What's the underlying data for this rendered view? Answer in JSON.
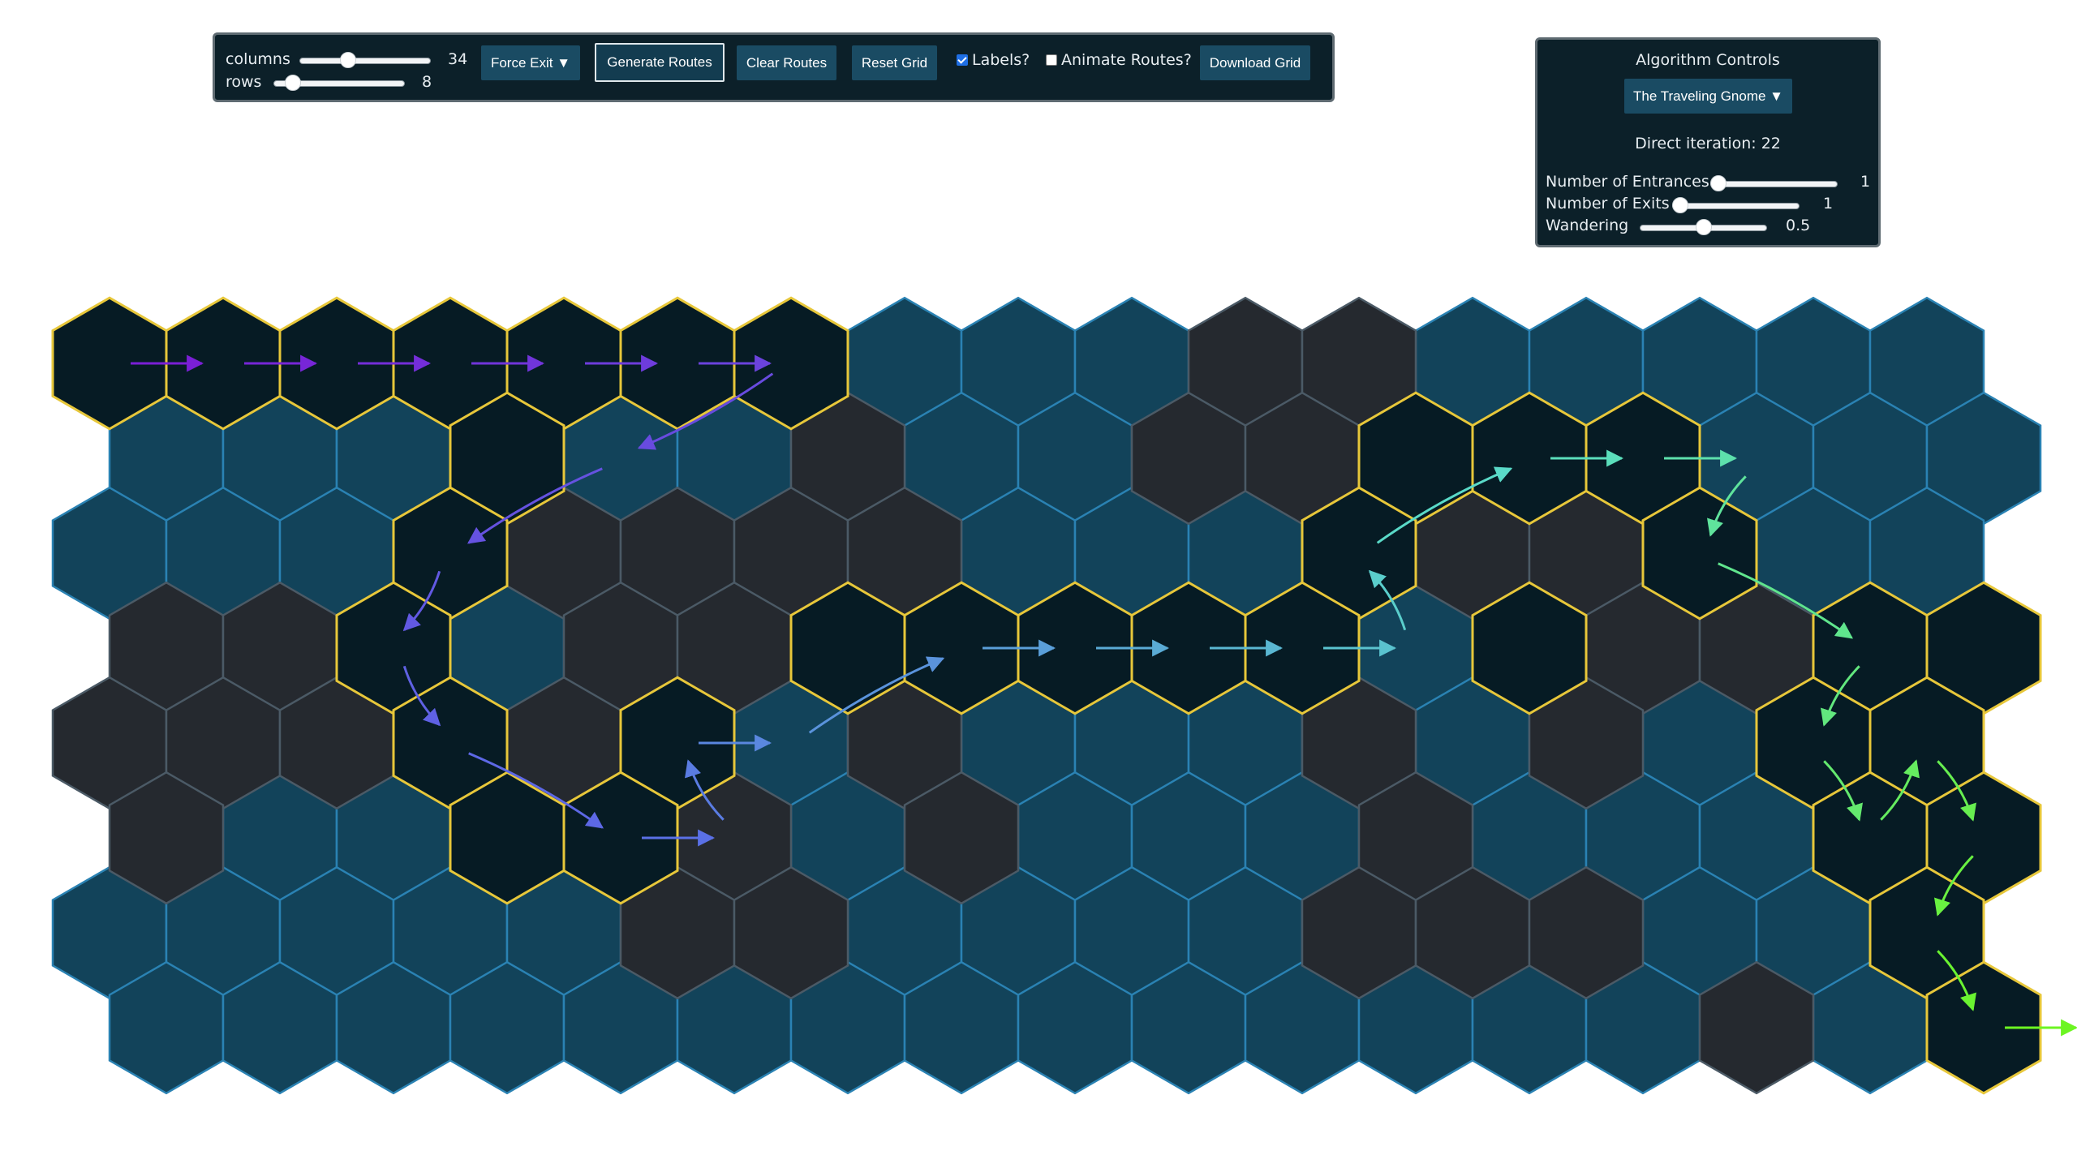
{
  "toolbar": {
    "columns_label": "columns",
    "columns_value": "34",
    "columns_fraction": 0.35,
    "rows_label": "rows",
    "rows_value": "8",
    "rows_fraction": 0.1,
    "force_exit_label": "Force Exit ▼",
    "generate_label": "Generate Routes",
    "clear_label": "Clear Routes",
    "reset_label": "Reset Grid",
    "labels_checkbox": "Labels?",
    "labels_checked": true,
    "animate_checkbox": "Animate Routes?",
    "animate_checked": false,
    "download_label": "Download Grid"
  },
  "algorithm": {
    "title": "Algorithm Controls",
    "selected_algorithm": "The Traveling Gnome ▼",
    "iteration_text": "Direct iteration: 22",
    "entrances_label": "Number of Entrances",
    "entrances_value": "1",
    "entrances_fraction": 0.0,
    "exits_label": "Number of Exits",
    "exits_value": "1",
    "exits_fraction": 0.0,
    "wandering_label": "Wandering",
    "wandering_value": "0.5",
    "wandering_fraction": 0.5
  },
  "colors": {
    "open_tile": "#12435a",
    "open_border": "#2a82b3",
    "blocked_tile": "#25292f",
    "blocked_border": "#4b5a66",
    "route_tile": "#061b24",
    "route_border": "#e7c73a"
  },
  "hex_grid": {
    "columns": 17,
    "rows": 8,
    "tiles": [
      "RRRRRRROOOBBOOOOO",
      "OOORO BOOBBRRROOO",
      "OOORBBBBOOORBBROO",
      "BBROBBRRRRRORBBRR",
      "BBBRBROBOOOBOBORR",
      "BOORRBOBOOOBOOORR",
      "OOOOOBBOOOOBBBOOR",
      "OOOOOOOOOOOOOOBOR"
    ],
    "route_start": "#7a1fd6",
    "route_end": "#6cf522",
    "route_cells": [
      [
        0,
        0
      ],
      [
        1,
        0
      ],
      [
        2,
        0
      ],
      [
        3,
        0
      ],
      [
        4,
        0
      ],
      [
        5,
        0
      ],
      [
        6,
        0
      ],
      [
        4,
        1
      ],
      [
        3,
        2
      ],
      [
        2,
        3
      ],
      [
        3,
        4
      ],
      [
        4,
        5
      ],
      [
        5,
        5
      ],
      [
        5,
        4
      ],
      [
        6,
        4
      ],
      [
        7,
        3
      ],
      [
        8,
        3
      ],
      [
        9,
        3
      ],
      [
        10,
        3
      ],
      [
        11,
        3
      ],
      [
        11,
        2
      ],
      [
        12,
        1
      ],
      [
        13,
        1
      ],
      [
        14,
        1
      ],
      [
        14,
        2
      ],
      [
        15,
        3
      ],
      [
        15,
        4
      ],
      [
        15,
        5
      ],
      [
        16,
        4
      ],
      [
        16,
        5
      ],
      [
        16,
        6
      ],
      [
        16,
        7
      ],
      [
        17,
        7
      ]
    ]
  }
}
